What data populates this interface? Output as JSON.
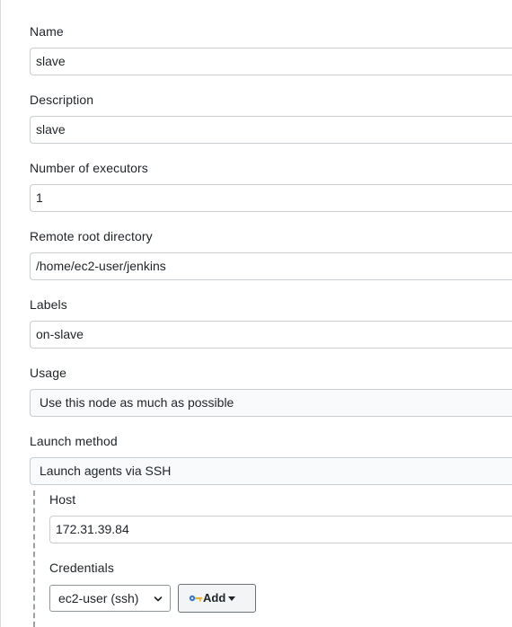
{
  "form": {
    "name": {
      "label": "Name",
      "value": "slave"
    },
    "description": {
      "label": "Description",
      "value": "slave"
    },
    "executors": {
      "label": "Number of executors",
      "value": "1"
    },
    "remote_root": {
      "label": "Remote root directory",
      "value": "/home/ec2-user/jenkins"
    },
    "labels": {
      "label": "Labels",
      "value": "on-slave"
    },
    "usage": {
      "label": "Usage",
      "value": "Use this node as much as possible"
    },
    "launch_method": {
      "label": "Launch method",
      "value": "Launch agents via SSH"
    },
    "host": {
      "label": "Host",
      "value": "172.31.39.84"
    },
    "credentials": {
      "label": "Credentials",
      "selected": "ec2-user (ssh)",
      "add_label": "Add",
      "add_icon": "key-icon",
      "dropdown_icon": "caret-down-icon"
    }
  },
  "colors": {
    "text": "#1f2328",
    "input_border": "#c9ced3",
    "button_border": "#6b7178",
    "button_bg": "#f3f4f5"
  }
}
